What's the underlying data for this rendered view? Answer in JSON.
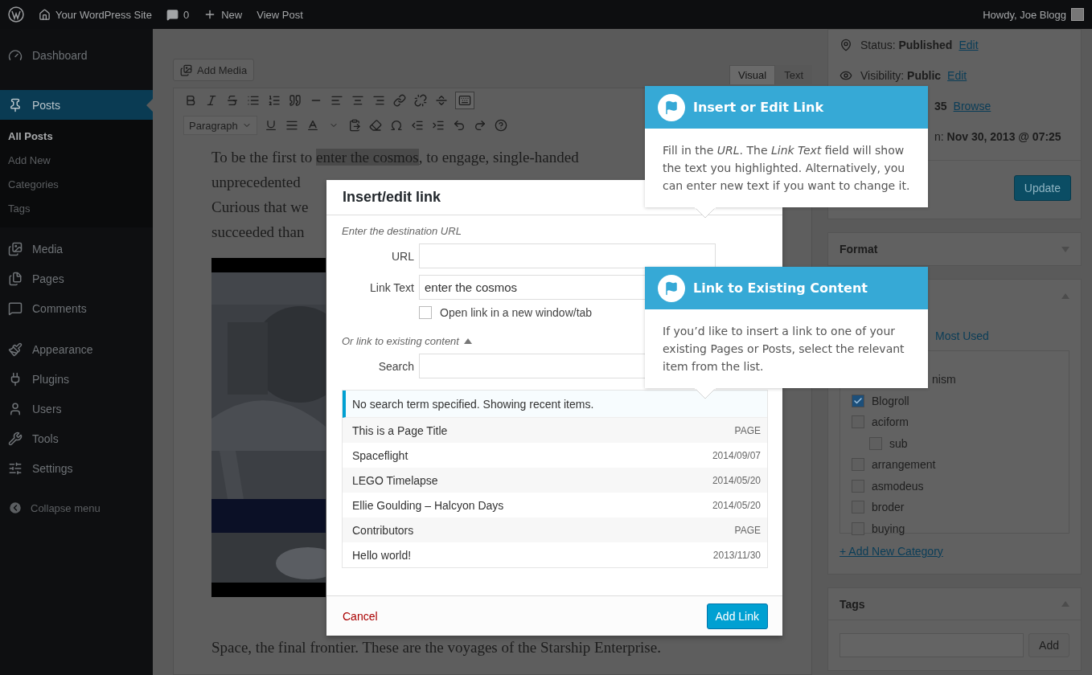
{
  "admin_bar": {
    "site_name": "Your WordPress Site",
    "comment_count": "0",
    "new_label": "New",
    "view_post": "View Post",
    "greeting": "Howdy, Joe Blogg"
  },
  "sidebar": {
    "groups": [
      [
        {
          "label": "Dashboard",
          "selected": false
        },
        {
          "label": "Posts",
          "selected": true,
          "children": [
            {
              "label": "All Posts",
              "selected": true
            },
            {
              "label": "Add New",
              "selected": false
            },
            {
              "label": "Categories",
              "selected": false
            },
            {
              "label": "Tags",
              "selected": false
            }
          ]
        },
        {
          "label": "Media",
          "selected": false
        },
        {
          "label": "Pages",
          "selected": false
        },
        {
          "label": "Comments",
          "selected": false
        }
      ],
      [
        {
          "label": "Appearance",
          "selected": false
        },
        {
          "label": "Plugins",
          "selected": false
        },
        {
          "label": "Users",
          "selected": false
        },
        {
          "label": "Tools",
          "selected": false
        },
        {
          "label": "Settings",
          "selected": false
        }
      ]
    ],
    "collapse": "Collapse menu"
  },
  "editor": {
    "add_media": "Add Media",
    "tabs": [
      {
        "label": "Visual",
        "selected": true
      },
      {
        "label": "Text",
        "selected": false
      }
    ],
    "toolbar_toggle_on": true,
    "format_select": "Paragraph",
    "lines": [
      {
        "segments": [
          {
            "text": "To be the first to ",
            "highlighted": false
          },
          {
            "text": "enter the cosmos",
            "highlighted": true
          },
          {
            "text": ", to engage, single-handed",
            "highlighted": false
          }
        ]
      },
      {
        "segments": [
          {
            "text": "unprecedented",
            "highlighted": false
          }
        ]
      },
      {
        "segments": [
          {
            "text": "Curious that we",
            "highlighted": false
          }
        ]
      },
      {
        "segments": [
          {
            "text": "succeeded than",
            "highlighted": false
          }
        ]
      }
    ],
    "closing_line": "Space, the final frontier. These are the voyages of the Starship Enterprise."
  },
  "publish_box": {
    "rows": [
      {
        "label": "Status:",
        "value": "Published",
        "link": "Edit"
      },
      {
        "label": "Visibility:",
        "value": "Public",
        "link": "Edit"
      },
      {
        "value": "35",
        "link": "Browse"
      },
      {
        "label": "n:",
        "value": "Nov 30, 2013 @ 07:25"
      }
    ],
    "update": "Update"
  },
  "format_box": {
    "title": "Format",
    "expanded": false
  },
  "categories_box": {
    "expanded": true,
    "tab": "Most Used",
    "items": [
      {
        "label": "nism"
      },
      {
        "label": "Blogroll",
        "checked": true
      },
      {
        "label": "aciform",
        "checked": false,
        "children": [
          {
            "label": "sub",
            "checked": false
          }
        ]
      },
      {
        "label": "arrangement",
        "checked": false
      },
      {
        "label": "asmodeus",
        "checked": false
      },
      {
        "label": "broder",
        "checked": false
      },
      {
        "label": "buying",
        "checked": false
      }
    ],
    "add_new": "+ Add New Category"
  },
  "tags_box": {
    "title": "Tags",
    "expanded": true,
    "add": "Add"
  },
  "dialog": {
    "title": "Insert/edit link",
    "hint": "Enter the destination URL",
    "url_label": "URL",
    "link_text_label": "Link Text",
    "link_text_value": "enter the cosmos",
    "new_tab": {
      "label": "Open link in a new window/tab",
      "checked": false
    },
    "existing_toggle": "Or link to existing content",
    "existing_expanded": true,
    "search_label": "Search",
    "notice": "No search term specified. Showing recent items.",
    "results": [
      {
        "title": "This is a Page Title",
        "info": "PAGE"
      },
      {
        "title": "Spaceflight",
        "info": "2014/09/07"
      },
      {
        "title": "LEGO Timelapse",
        "info": "2014/05/20"
      },
      {
        "title": "Ellie Goulding – Halcyon Days",
        "info": "2014/05/20"
      },
      {
        "title": "Contributors",
        "info": "PAGE"
      },
      {
        "title": "Hello world!",
        "info": "2013/11/30"
      }
    ],
    "cancel": "Cancel",
    "submit": "Add Link"
  },
  "tooltips": [
    {
      "title": "Insert or Edit Link",
      "body": "Fill in the *URL*. The *Link Text* field will show the text you highlighted. Alternatively, you can enter new text if you want to change it."
    },
    {
      "title": "Link to Existing Content",
      "body": "If you’d like to insert a link to one of your existing Pages or Posts, select the relevant item from the list."
    }
  ]
}
